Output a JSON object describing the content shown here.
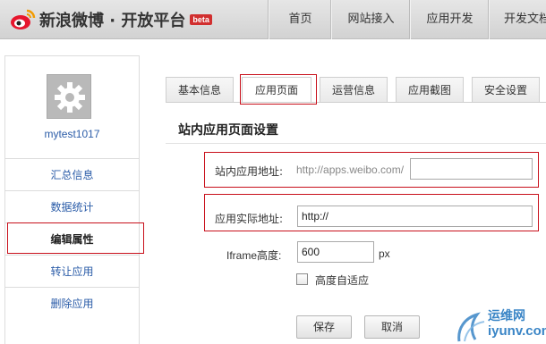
{
  "header": {
    "site_title": "新浪微博 · 开放平台",
    "beta_badge": "beta",
    "nav": [
      "首页",
      "网站接入",
      "应用开发",
      "开发文档"
    ]
  },
  "sidebar": {
    "username": "mytest1017",
    "avatar_icon": "gear-icon",
    "items": [
      "汇总信息",
      "数据统计",
      "编辑属性",
      "转让应用",
      "删除应用"
    ],
    "active_item": "编辑属性"
  },
  "tabs": [
    "基本信息",
    "应用页面",
    "运营信息",
    "应用截图",
    "安全设置"
  ],
  "active_tab": "应用页面",
  "section_title": "站内应用页面设置",
  "form": {
    "site_url_label": "站内应用地址:",
    "site_url_prefix": "http://apps.weibo.com/",
    "site_url_value": "",
    "real_url_label": "应用实际地址:",
    "real_url_value": "http://",
    "iframe_label": "Iframe高度:",
    "iframe_value": "600",
    "iframe_unit": "px",
    "auto_height_label": "高度自适应",
    "auto_height_checked": false
  },
  "buttons": {
    "save": "保存",
    "cancel": "取消"
  },
  "watermark": {
    "line1": "运维网",
    "line2": "iyunv.com"
  },
  "colors": {
    "highlight_red": "#c8101b",
    "link_blue": "#2b5ca8"
  }
}
